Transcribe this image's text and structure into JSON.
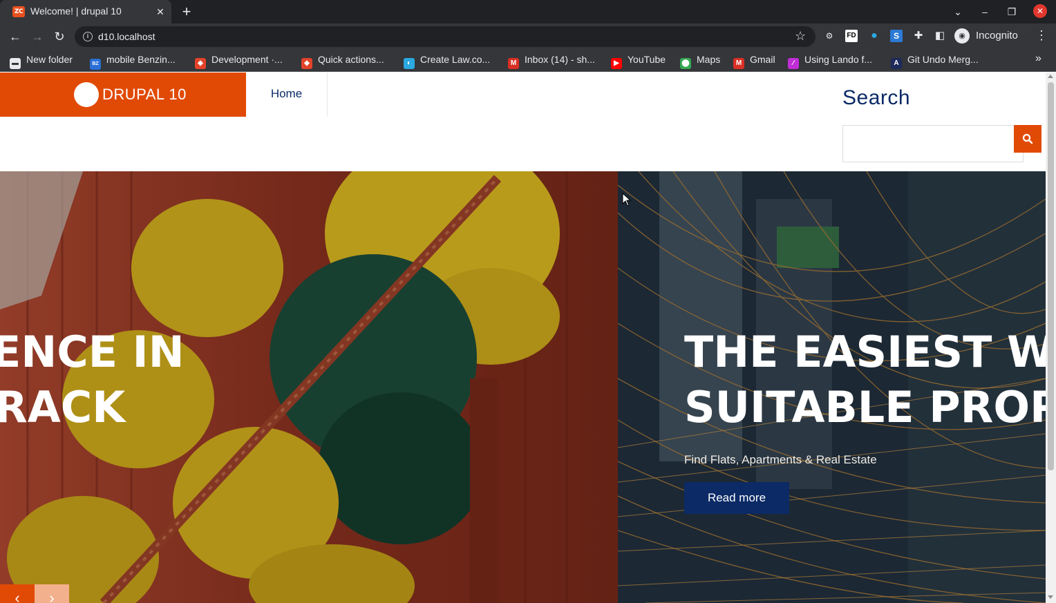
{
  "browser": {
    "tab_title": "Welcome! | drupal 10",
    "favicon_text": "ZC",
    "url": "d10.localhost",
    "profile_label": "Incognito",
    "bookmarks": [
      {
        "label": "New folder",
        "icon": "folder-icon",
        "color": "#e8eaed"
      },
      {
        "label": "mobile Benzin...",
        "icon": "bz-icon",
        "color": "#2b6fd6"
      },
      {
        "label": "Development ·...",
        "icon": "gitlab-icon",
        "color": "#e2432a"
      },
      {
        "label": "Quick actions...",
        "icon": "gitlab-icon",
        "color": "#e2432a"
      },
      {
        "label": "Create Law.co...",
        "icon": "drupal-icon",
        "color": "#2ba9e0"
      },
      {
        "label": "Inbox (14) - sh...",
        "icon": "gmail-icon",
        "color": "#d93025"
      },
      {
        "label": "YouTube",
        "icon": "youtube-icon",
        "color": "#ff0000"
      },
      {
        "label": "Maps",
        "icon": "maps-icon",
        "color": "#34a853"
      },
      {
        "label": "Gmail",
        "icon": "gmail-icon",
        "color": "#d93025"
      },
      {
        "label": "Using Lando f...",
        "icon": "lando-icon",
        "color": "#c02dd6"
      },
      {
        "label": "Git Undo Merg...",
        "icon": "git-icon",
        "color": "#1e2a5a"
      }
    ]
  },
  "site": {
    "logo_text": "DRUPAL 10",
    "nav": {
      "home": "Home"
    },
    "search": {
      "title": "Search",
      "placeholder": ""
    },
    "colors": {
      "brand": "#e14a05",
      "navy": "#0b2a66"
    }
  },
  "slider": {
    "slide1": {
      "line1": "ENCE IN",
      "line2": "RACK"
    },
    "slide2": {
      "line1": "THE EASIEST WA",
      "line2": "SUITABLE PROPE",
      "subtitle": "Find Flats, Apartments & Real Estate",
      "button": "Read more"
    },
    "prev_label": "‹",
    "next_label": "›"
  }
}
